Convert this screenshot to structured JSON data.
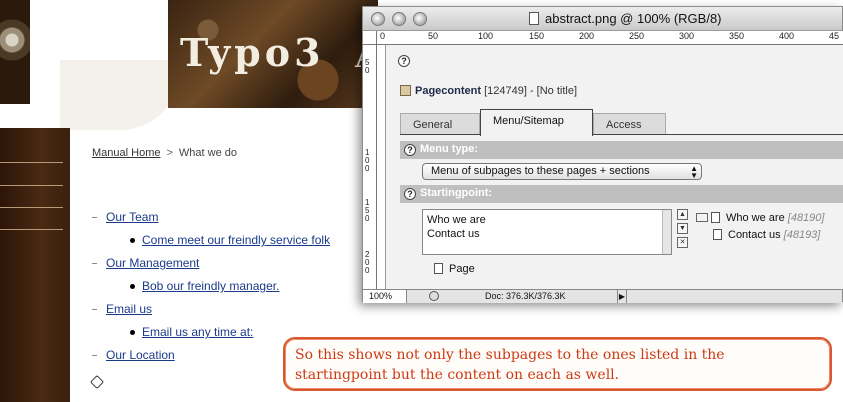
{
  "site": {
    "brand_title": "Typo3",
    "brand_trailing": "A",
    "breadcrumb": {
      "home": "Manual Home",
      "separator": ">",
      "current": "What we do"
    },
    "menu": [
      {
        "label": "Our Team",
        "children": [
          "Come meet our freindly service folk"
        ]
      },
      {
        "label": "Our Management",
        "children": [
          "Bob our freindly manager."
        ]
      },
      {
        "label": "Email us",
        "children": [
          "Email us any time at:"
        ]
      },
      {
        "label": "Our Location",
        "children": []
      }
    ]
  },
  "window": {
    "title": "abstract.png @ 100% (RGB/8)",
    "ruler_top_labels": [
      "0",
      "50",
      "100",
      "150",
      "200",
      "250",
      "300",
      "350",
      "400",
      "45"
    ],
    "ruler_left_labels": [
      "5 0",
      "1 0 0",
      "1 5 0",
      "2 0 0"
    ],
    "content": {
      "help_glyph": "?",
      "pagecontent_label": "Pagecontent",
      "pagecontent_meta": "[124749] - [No title]",
      "tabs": [
        "General",
        "Menu/Sitemap",
        "Access"
      ],
      "active_tab": "Menu/Sitemap",
      "menu_type_label": "Menu type:",
      "menu_type_value": "Menu of subpages to these pages + sections",
      "startingpoint_label": "Startingpoint:",
      "selected_items": [
        "Who we are",
        "Contact us"
      ],
      "tree": [
        {
          "label": "Who we are",
          "id": "[48190]"
        },
        {
          "label": "Contact us",
          "id": "[48193]"
        }
      ],
      "page_label": "Page",
      "sp_buttons": [
        "▲",
        "▼",
        "✕"
      ]
    },
    "status": {
      "zoom": "100%",
      "doc": "Doc: 376.3K/376.3K",
      "arrow": "▶"
    }
  },
  "callout": {
    "text": "So this shows not only the subpages to the ones listed in the startingpoint but the content on each as well."
  }
}
